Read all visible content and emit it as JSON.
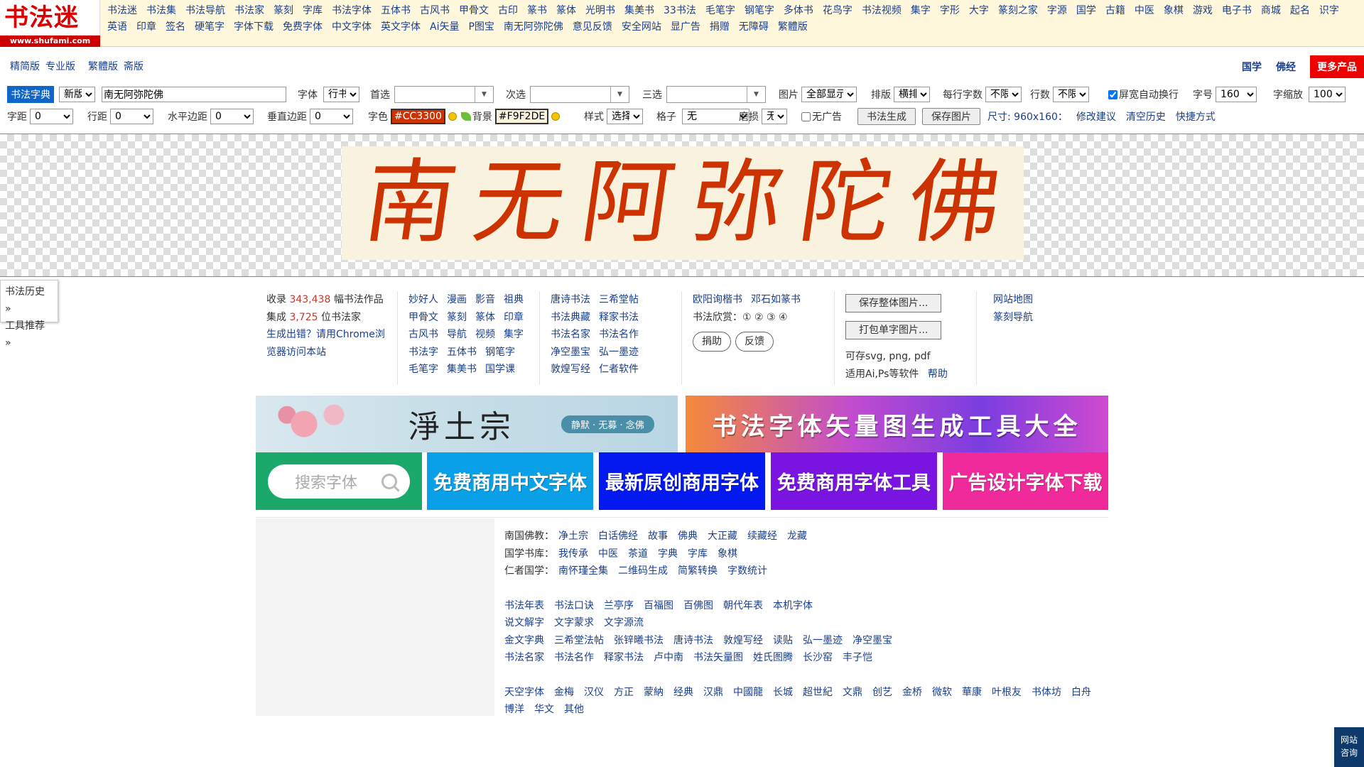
{
  "logo": {
    "title": "书法迷",
    "domain": "www.shufami.com"
  },
  "top_links": [
    "书法迷",
    "书法集",
    "书法导航",
    "书法家",
    "篆刻",
    "字库",
    "书法字体",
    "五体书",
    "古风书",
    "甲骨文",
    "古印",
    "篆书",
    "篆体",
    "光明书",
    "集美书",
    "33书法",
    "毛笔字",
    "钢笔字",
    "多体书",
    "花鸟字",
    "书法视频",
    "集字",
    "字形",
    "大字",
    "篆刻之家",
    "字源",
    "国学",
    "古籍",
    "中医",
    "象棋",
    "游戏",
    "电子书",
    "商城",
    "起名",
    "识字",
    "英语",
    "印章",
    "签名",
    "硬笔字",
    "字体下载",
    "免费字体",
    "中文字体",
    "英文字体",
    "Ai矢量",
    "P图宝",
    "南无阿弥陀佛",
    "意见反馈",
    "安全网站",
    "显广告",
    "捐赠",
    "无障碍",
    "繁體版"
  ],
  "editions": [
    "精简版",
    "专业版",
    "繁體版",
    "斋版"
  ],
  "right_links": {
    "guoxue": "国学",
    "fojing": "佛经",
    "more": "更多产品"
  },
  "controls": {
    "dict_label": "书法字典",
    "version": "新版",
    "text_value": "南无阿弥陀佛",
    "font_label": "字体",
    "font_value": "行书",
    "first_label": "首选",
    "second_label": "次选",
    "third_label": "三选",
    "image_label": "图片",
    "image_value": "全部显示",
    "layout_label": "排版",
    "layout_value": "横排",
    "per_row_label": "每行字数",
    "per_row_value": "不限",
    "rows_label": "行数",
    "rows_value": "不限",
    "wrap_label": "屏宽自动换行",
    "size_label": "字号",
    "size_value": "160",
    "scale_label": "字缩放",
    "scale_value": "100",
    "char_spacing_label": "字距",
    "char_spacing_value": "0",
    "line_spacing_label": "行距",
    "line_spacing_value": "0",
    "h_margin_label": "水平边距",
    "h_margin_value": "0",
    "v_margin_label": "垂直边距",
    "v_margin_value": "0",
    "color_label": "字色",
    "color_value": "#CC3300",
    "bg_label": "背景",
    "bg_value": "#F9F2DE",
    "style_label": "样式",
    "style_value": "选择",
    "grid_label": "格子",
    "grid_value": "无",
    "wear_label": "磨损",
    "wear_value": "无",
    "noad_label": "无广告",
    "generate_button": "书法生成",
    "save_button": "保存图片",
    "size_info": "尺寸: 960x160：",
    "suggest_link": "修改建议",
    "clear_link": "清空历史",
    "shortcut_link": "快捷方式"
  },
  "preview": {
    "chars": [
      "南",
      "无",
      "阿",
      "弥",
      "陀",
      "佛"
    ],
    "color": "#CC3300",
    "bg": "#F9F2DE"
  },
  "side_tab": [
    "书法历史 »",
    "工具推荐 »"
  ],
  "stats": {
    "line1_pre": "收录",
    "works": "343,438",
    "line1_post": "幅书法作品",
    "line2_pre": "集成",
    "artists": "3,725",
    "line2_post": "位书法家",
    "browser_note_1": "生成出错？请用Chrome浏",
    "browser_note_2": "览器访问本站"
  },
  "col_links_1": [
    "妙好人",
    "漫画",
    "影音",
    "祖典",
    "甲骨文",
    "篆刻",
    "篆体",
    "印章",
    "古风书",
    "导航",
    "视频",
    "集字",
    "书法字",
    "五体书",
    "钢笔字",
    "毛笔字",
    "集美书",
    "国学课"
  ],
  "col_links_2": [
    "唐诗书法",
    "三希堂帖",
    "书法典藏",
    "释家书法",
    "书法名家",
    "书法名作",
    "净空墨宝",
    "弘一墨迹",
    "敦煌写经",
    "仁者软件"
  ],
  "col_links_3": {
    "a": "欧阳询楷书",
    "b": "邓石如篆书",
    "appreciate": "书法欣赏：① ② ③ ④",
    "donate": "捐助",
    "feedback": "反馈"
  },
  "col_tools": {
    "save_all": "保存整体图片...",
    "pack": "打包单字图片...",
    "formats": "可存svg, png, pdf",
    "software": "适用Ai,Ps等软件",
    "help": "帮助"
  },
  "col_site": [
    "网站地图",
    "篆刻导航"
  ],
  "banners": {
    "jingtu": "淨土宗",
    "jingtu_sub": "静默 · 无募 · 念佛",
    "vector": "书法字体矢量图生成工具大全"
  },
  "search_placeholder": "搜索字体",
  "tiles": [
    "免费商用中文字体",
    "最新原创商用字体",
    "免费商用字体工具",
    "广告设计字体下载"
  ],
  "links_rows": [
    [
      "南国佛教：",
      "净土宗",
      "白话佛经",
      "故事",
      "佛典",
      "大正藏",
      "续藏经",
      "龙藏"
    ],
    [
      "国学书库：",
      "我传承",
      "中医",
      "茶道",
      "字典",
      "字库",
      "象棋"
    ],
    [
      "仁者国学：",
      "南怀瑾全集",
      "二维码生成",
      "简繁转换",
      "字数统计"
    ],
    [],
    [
      "书法年表",
      "书法口诀",
      "兰亭序",
      "百福图",
      "百佛图",
      "朝代年表",
      "本机字体"
    ],
    [
      "说文解字",
      "文字蒙求",
      "文字源流"
    ],
    [
      "金文字典",
      "三希堂法帖",
      "张锌曦书法",
      "唐诗书法",
      "敦煌写经",
      "读贴",
      "弘一墨迹",
      "净空墨宝"
    ],
    [
      "书法名家",
      "书法名作",
      "释家书法",
      "卢中南",
      "书法矢量图",
      "姓氏图腾",
      "长沙窑",
      "丰子恺"
    ],
    [],
    [
      "天空字体",
      "金梅",
      "汉仪",
      "方正",
      "蒙納",
      "经典",
      "汉鼎",
      "中國龍",
      "长城",
      "超世紀",
      "文鼎",
      "创艺",
      "金桥",
      "微软",
      "華康",
      "叶根友",
      "书体坊",
      "白舟",
      "博洋",
      "华文",
      "其他"
    ]
  ],
  "fab": [
    "网站",
    "咨询"
  ]
}
